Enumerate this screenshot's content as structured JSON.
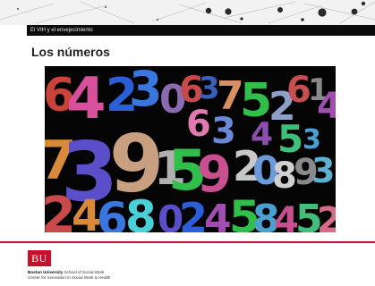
{
  "slide": {
    "section_title": "El VIH y el envejecimiento",
    "heading": "Los números",
    "image": {
      "semantic": "colorful-numbers-photo",
      "background": "#050505"
    }
  },
  "footer": {
    "logo_text": "BU",
    "university": "Boston University",
    "school": " School of Social Work",
    "center": "Center for Innovation in Social Work & Health"
  },
  "colors": {
    "accent_red": "#c8102e",
    "title_bar": "#0b0b0b"
  }
}
